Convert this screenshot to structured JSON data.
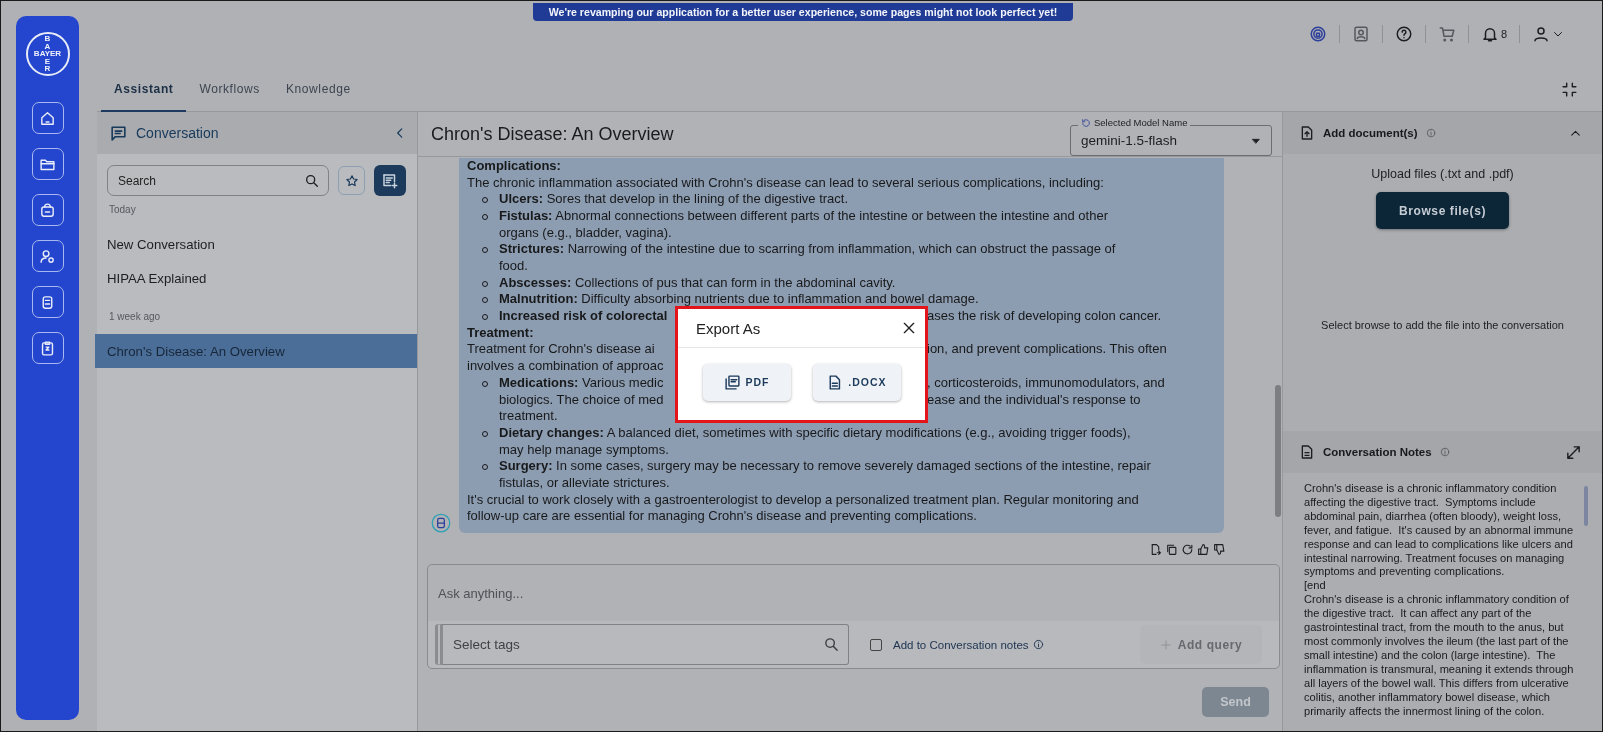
{
  "banner": "We're revamping our application for a better user experience, some pages might not look perfect yet!",
  "logo": {
    "top": "BA",
    "middle": "BAYER",
    "bottom": "ER"
  },
  "header": {
    "notification_count": "8"
  },
  "tabs": [
    {
      "label": "Assistant",
      "selected": true
    },
    {
      "label": "Workflows",
      "selected": false
    },
    {
      "label": "Knowledge",
      "selected": false
    }
  ],
  "conversation_panel": {
    "title": "Conversation",
    "search": {
      "placeholder": "Search"
    },
    "groups": [
      {
        "label": "Today",
        "items": [
          {
            "title": "New Conversation",
            "selected": false
          },
          {
            "title": "HIPAA Explained",
            "selected": false
          }
        ]
      },
      {
        "label": "1 week ago",
        "items": [
          {
            "title": "Chron's Disease: An Overview",
            "selected": true
          }
        ]
      }
    ]
  },
  "chat": {
    "title": "Chron's Disease: An Overview",
    "model_select": {
      "label": "Selected Model Name",
      "value": "gemini-1.5-flash"
    },
    "message": {
      "lines": [
        {
          "kind": "heading",
          "text": "Complications:"
        },
        {
          "kind": "text",
          "text": "The chronic inflammation associated with Crohn's disease can lead to several serious complications, including:"
        },
        {
          "kind": "bullet",
          "text": "**Ulcers:** Sores that develop in the lining of the digestive tract."
        },
        {
          "kind": "bullet",
          "text": "**Fistulas:** Abnormal connections between different parts of the intestine or between the intestine and other"
        },
        {
          "kind": "cont",
          "text": "organs (e.g., bladder, vagina)."
        },
        {
          "kind": "bullet",
          "text": "**Strictures:** Narrowing of the intestine due to scarring from inflammation, which can obstruct the passage of"
        },
        {
          "kind": "cont",
          "text": "food."
        },
        {
          "kind": "bullet",
          "text": "**Abscesses:** Collections of pus that can form in the abdominal cavity."
        },
        {
          "kind": "bullet",
          "text": "**Malnutrition:** Difficulty absorbing nutrients due to inflammation and bowel damage."
        },
        {
          "kind": "bullet",
          "left": "Increased risk of colorectal",
          "left_bold": true,
          "right": "ases the risk of developing colon cancer."
        },
        {
          "kind": "heading",
          "text": "Treatment:"
        },
        {
          "kind": "text",
          "left": "Treatment for Crohn's disease ai",
          "right": "ion, and prevent complications. This often"
        },
        {
          "kind": "text",
          "left": "involves a combination of approac"
        },
        {
          "kind": "bullet",
          "left": "**Medications:** Various medic",
          "right": ", corticosteroids, immunomodulators, and"
        },
        {
          "kind": "cont",
          "left": "biologics. The choice of med",
          "right": "ease and the individual's response to"
        },
        {
          "kind": "cont",
          "text": "treatment."
        },
        {
          "kind": "bullet",
          "text": "**Dietary changes:** A balanced diet, sometimes with specific dietary modifications (e.g., avoiding trigger foods),"
        },
        {
          "kind": "cont",
          "text": "may help manage symptoms."
        },
        {
          "kind": "bullet",
          "text": "**Surgery:** In some cases, surgery may be necessary to remove severely damaged sections of the intestine, repair"
        },
        {
          "kind": "cont",
          "text": "fistulas, or alleviate strictures."
        },
        {
          "kind": "text",
          "text": "It's crucial to work closely with a gastroenterologist to develop a personalized treatment plan. Regular monitoring and"
        },
        {
          "kind": "text",
          "text": "follow-up care are essential for managing Crohn's disease and preventing complications."
        }
      ]
    },
    "input": {
      "placeholder": "Ask anything...",
      "tags": {
        "placeholder": "Select tags"
      },
      "add_to_notes": {
        "label": "Add to Conversation notes",
        "checked": false
      },
      "add_query": {
        "label": "Add query",
        "disabled": true
      },
      "send": {
        "label": "Send",
        "disabled": true
      }
    }
  },
  "documents_panel": {
    "title": "Add document(s)",
    "expanded": true,
    "upload_hint": "Upload files (.txt and .pdf)",
    "browse_button": "Browse file(s)",
    "hint": "Select browse to add the file into the conversation"
  },
  "notes_panel": {
    "title": "Conversation Notes",
    "paragraphs": [
      "Crohn's disease is a chronic inflammatory condition affecting the digestive tract.  Symptoms include abdominal pain, diarrhea (often bloody), weight loss, fever, and fatigue.  It's caused by an abnormal immune response and can lead to complications like ulcers and intestinal narrowing. Treatment focuses on managing symptoms and preventing complications.",
      "[end",
      "Crohn's disease is a chronic inflammatory condition of the digestive tract.  It can affect any part of the gastrointestinal tract, from the mouth to the anus, but most commonly involves the ileum (the last part of the small intestine) and the colon (large intestine).  The inflammation is transmural, meaning it extends through all layers of the bowel wall. This differs from ulcerative colitis, another inflammatory bowel disease, which primarily affects the innermost lining of the colon."
    ]
  },
  "modal": {
    "title": "Export As",
    "options": [
      {
        "kind": "pdf",
        "label": "PDF"
      },
      {
        "kind": "docx",
        "label": ".DOCX"
      }
    ]
  }
}
